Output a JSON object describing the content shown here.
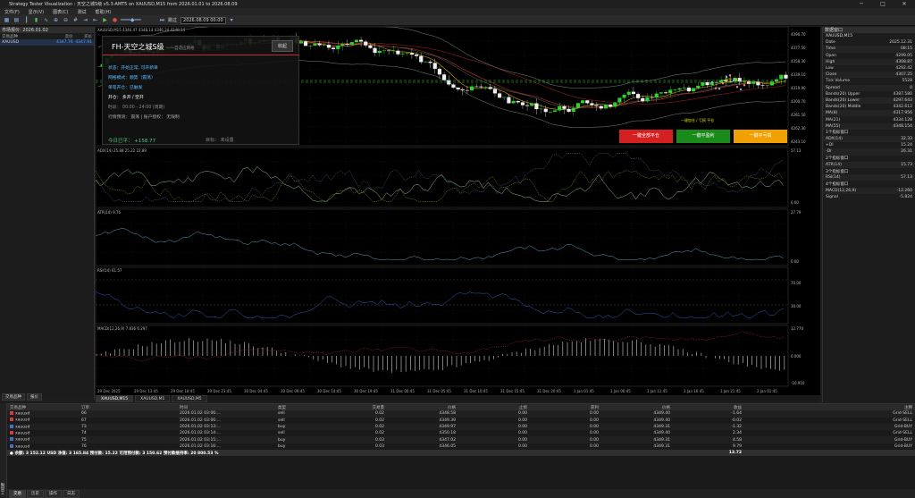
{
  "window": {
    "title": "Strategy Tester Visualization : 天空之城S级 v5.3-AMT5 on XAUUSD,M15 from 2026.01.01 to 2026.08.09",
    "controls": [
      "─",
      "□",
      "✕"
    ]
  },
  "menu": [
    "文件(F)",
    "显示(V)",
    "图表(C)",
    "测试",
    "帮助(H)"
  ],
  "toolbar": {
    "speed_label": "跳过",
    "date": "2026.08.09 00:00"
  },
  "market_watch": {
    "title": "市场报价: 2026.01.02",
    "columns": [
      "交易品种",
      "卖价",
      "买价"
    ],
    "rows": [
      {
        "symbol": "XAUUSD",
        "bid": "4347.76",
        "ask": "4347.91"
      }
    ],
    "tabs": [
      "交易品种",
      "报价"
    ]
  },
  "chart": {
    "main_label": "XAUUSD,M15  4346.47 4348.14 4346.24 4348.14",
    "adx_label": "ADX(14) 25.88 25.22 22.89",
    "atr_label": "ATR(14) 9.76",
    "rsi_label": "RSI(14) 61.57",
    "macd_label": "MACD(12,26,9) 7.836 6.297",
    "price_ticks": [
      "4396.70",
      "4377.50",
      "4358.30",
      "4339.10",
      "4319.90",
      "4300.70",
      "4281.50",
      "4262.30",
      "4243.10"
    ],
    "adx_ticks": [
      "57.13",
      "0.00"
    ],
    "atr_ticks": [
      "27.79",
      "0.00"
    ],
    "rsi_ticks": [
      "70.00",
      "30.00"
    ],
    "macd_ticks": [
      "12.770",
      "0.000",
      "-16.910"
    ],
    "time_ticks": [
      "29 Dec 2025",
      "29 Dec 13:45",
      "29 Dec 18:45",
      "29 Dec 23:45",
      "30 Dec 04:45",
      "30 Dec 09:45",
      "30 Dec 14:45",
      "30 Dec 19:45",
      "31 Dec 00:45",
      "31 Dec 05:45",
      "31 Dec 10:45",
      "31 Dec 15:45",
      "31 Dec 20:45",
      "1 Jan 01:45",
      "1 Jan 06:45",
      "1 Jan 11:45",
      "1 Jan 16:45",
      "1 Jan 21:45",
      "2 Jan 01:45"
    ],
    "annotations": {
      "tp": "一键平 TP",
      "sl_hint": "一键加仓 / 亏损 平仓"
    },
    "tabs": [
      "XAUUSD,M15",
      "XAUUSD,M1",
      "XAUUSD,M5"
    ]
  },
  "panel": {
    "title": "FH-天空之城S级",
    "subtitle": "——自适应网格",
    "close_label": "收起",
    "lines": [
      {
        "text": "状态：开始正常, 可开新单",
        "color": "#5fbfff"
      },
      {
        "text": "网格模式：顺势（震荡）",
        "color": "#5fbfff"
      },
      {
        "text": "单笔开仓：已触发",
        "color": "#5fbfff"
      },
      {
        "text": "开仓：   多开 / 空开",
        "color": "#ffffff"
      },
      {
        "text": "时段：   00:00 - 24:00 (周期)",
        "color": "#888888"
      },
      {
        "text": "行情预测：  震荡  |  账户授权：  无限制",
        "color": "#aaaaaa"
      }
    ],
    "profit_label": "今日已平：",
    "profit_value": "+158.77",
    "target_label": "目标：",
    "target_value": "未设置",
    "buttons": [
      {
        "label": "一键全部平仓",
        "color": "#d42020"
      },
      {
        "label": "一键平盈利",
        "color": "#1a8a1a"
      },
      {
        "label": "一键平亏损",
        "color": "#f0a000"
      }
    ]
  },
  "data_window": {
    "title": "数据窗口",
    "symbol": "XAUUSD,M15",
    "rows": [
      {
        "k": "Date",
        "v": "2025.12.31"
      },
      {
        "k": "Time",
        "v": "08:15"
      },
      {
        "k": "Open",
        "v": "4299.05"
      },
      {
        "k": "High",
        "v": "4308.87"
      },
      {
        "k": "Low",
        "v": "4292.42"
      },
      {
        "k": "Close",
        "v": "4307.25"
      },
      {
        "k": "Tick Volume",
        "v": "5528"
      },
      {
        "k": "Spread",
        "v": "0"
      },
      {
        "k": "Bands(20) Upper",
        "v": "4387.580"
      },
      {
        "k": "Bands(20) Lower",
        "v": "4297.643"
      },
      {
        "k": "Bands(20) Middle",
        "v": "4342.612"
      },
      {
        "k": "MA(8)",
        "v": "4317.956"
      },
      {
        "k": "MA(21)",
        "v": "4334.128"
      },
      {
        "k": "MA(55)",
        "v": "4348.154"
      },
      {
        "k": "1个指标窗口",
        "v": "",
        "grp": true
      },
      {
        "k": "ADX(14)",
        "v": "32.33"
      },
      {
        "k": "+DI",
        "v": "15.24"
      },
      {
        "k": "-DI",
        "v": "26.31"
      },
      {
        "k": "2个指标窗口",
        "v": "",
        "grp": true
      },
      {
        "k": "ATR(14)",
        "v": "15.73"
      },
      {
        "k": "3个指标窗口",
        "v": "",
        "grp": true
      },
      {
        "k": "RSI(14)",
        "v": "57.13"
      },
      {
        "k": "4个指标窗口",
        "v": "",
        "grp": true
      },
      {
        "k": "MACD(12,26,9)",
        "v": "-12.260"
      },
      {
        "k": "Signal",
        "v": "-5.824"
      }
    ]
  },
  "trade": {
    "columns": [
      "交易品种",
      "订单",
      "时间",
      "类型",
      "交易量",
      "价格",
      "止损",
      "获利",
      "价格",
      "收益",
      "注释"
    ],
    "rows": [
      {
        "sym": "xauusd",
        "id": "66",
        "time": "2026.01.02 03:06:...",
        "type": "sell",
        "vol": "0.02",
        "price": "4348.58",
        "sl": "0.00",
        "tp": "0.00",
        "cur": "4349.40",
        "profit": "-1.64",
        "comment": "Grid-SELL",
        "color": "#d04040"
      },
      {
        "sym": "xauusd",
        "id": "67",
        "time": "2026.01.02 03:06:...",
        "type": "sell",
        "vol": "0.02",
        "price": "4349.39",
        "sl": "0.00",
        "tp": "0.00",
        "cur": "4349.40",
        "profit": "-0.02",
        "comment": "Grid-SELL",
        "color": "#d04040"
      },
      {
        "sym": "xauusd",
        "id": "73",
        "time": "2026.01.02 03:13:...",
        "type": "buy",
        "vol": "0.02",
        "price": "4349.97",
        "sl": "0.00",
        "tp": "0.00",
        "cur": "4349.31",
        "profit": "-1.32",
        "comment": "Grid-BUY",
        "color": "#4070d0"
      },
      {
        "sym": "xauusd",
        "id": "74",
        "time": "2026.01.02 03:14:...",
        "type": "sell",
        "vol": "0.02",
        "price": "4350.18",
        "sl": "0.00",
        "tp": "0.00",
        "cur": "4349.40",
        "profit": "2.34",
        "comment": "Grid-SELL",
        "color": "#d04040"
      },
      {
        "sym": "xauusd",
        "id": "75",
        "time": "2026.01.02 03:15:...",
        "type": "buy",
        "vol": "0.03",
        "price": "4347.02",
        "sl": "0.00",
        "tp": "0.00",
        "cur": "4349.31",
        "profit": "4.58",
        "comment": "Grid-BUY",
        "color": "#4070d0"
      },
      {
        "sym": "xauusd",
        "id": "76",
        "time": "2026.01.02 03:16:...",
        "type": "buy",
        "vol": "0.03",
        "price": "4346.05",
        "sl": "0.00",
        "tp": "0.00",
        "cur": "4349.31",
        "profit": "9.79",
        "comment": "Grid-BUY",
        "color": "#4070d0"
      }
    ],
    "summary": "● 余额: 3 152.12 USD  净值: 3 165.84  预付款: 15.22  可用预付款: 3 150.62  预付款维持率: 20 800.53 %",
    "summary_profit": "13.72",
    "tabs": [
      "交易",
      "历史",
      "操作",
      "日志"
    ],
    "side_label": "工具箱"
  }
}
